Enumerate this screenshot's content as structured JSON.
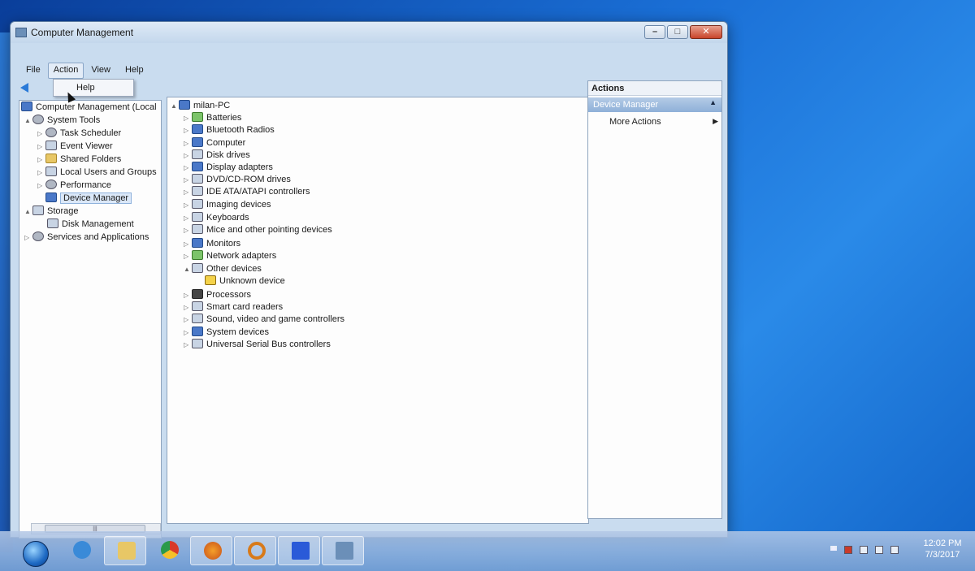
{
  "window": {
    "title": "Computer Management"
  },
  "menu": {
    "items": [
      "File",
      "Action",
      "View",
      "Help"
    ]
  },
  "dropdown": {
    "item": "Help"
  },
  "left_tree": [
    {
      "label": "Computer Management (Local",
      "level": 0,
      "expander": ""
    },
    {
      "label": "System Tools",
      "level": 1,
      "expander": "▲"
    },
    {
      "label": "Task Scheduler",
      "level": 2,
      "expander": "▷"
    },
    {
      "label": "Event Viewer",
      "level": 2,
      "expander": "▷"
    },
    {
      "label": "Shared Folders",
      "level": 2,
      "expander": "▷"
    },
    {
      "label": "Local Users and Groups",
      "level": 2,
      "expander": "▷"
    },
    {
      "label": "Performance",
      "level": 2,
      "expander": "▷"
    },
    {
      "label": "Device Manager",
      "level": 2,
      "expander": ""
    },
    {
      "label": "Storage",
      "level": 1,
      "expander": "▲"
    },
    {
      "label": "Disk Management",
      "level": 2,
      "expander": ""
    },
    {
      "label": "Services and Applications",
      "level": 1,
      "expander": "▷"
    }
  ],
  "device_tree": {
    "root": "milan-PC",
    "items": [
      "Batteries",
      "Bluetooth Radios",
      "Computer",
      "Disk drives",
      "Display adapters",
      "DVD/CD-ROM drives",
      "IDE ATA/ATAPI controllers",
      "Imaging devices",
      "Keyboards",
      "Mice and other pointing devices",
      "Monitors",
      "Network adapters",
      "Other devices",
      "Unknown device",
      "Processors",
      "Smart card readers",
      "Sound, video and game controllers",
      "System devices",
      "Universal Serial Bus controllers"
    ]
  },
  "actions": {
    "header": "Actions",
    "group": "Device Manager",
    "item": "More Actions"
  },
  "clock": {
    "time": "12:02 PM",
    "date": "7/3/2017"
  }
}
